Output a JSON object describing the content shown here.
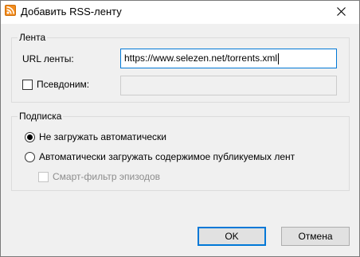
{
  "window": {
    "title": "Добавить RSS-ленту",
    "app_icon": "rss-feed-icon",
    "close_icon": "close-icon"
  },
  "feed_group": {
    "legend": "Лента",
    "url_label": "URL ленты:",
    "url_value": "https://www.selezen.net/torrents.xml",
    "alias_label": "Псевдоним:",
    "alias_checked": false,
    "alias_value": ""
  },
  "subscription_group": {
    "legend": "Подписка",
    "option_no_auto": "Не загружать автоматически",
    "option_auto": "Автоматически загружать содержимое публикуемых лент",
    "selected_option": "option_no_auto",
    "smart_filter_label": "Смарт-фильтр эпизодов",
    "smart_filter_checked": false,
    "smart_filter_enabled": false
  },
  "buttons": {
    "ok": "OK",
    "cancel": "Отмена"
  },
  "colors": {
    "accent": "#0078d7",
    "rss_orange": "#f28c1e",
    "disabled_text": "#8d8d8d"
  }
}
